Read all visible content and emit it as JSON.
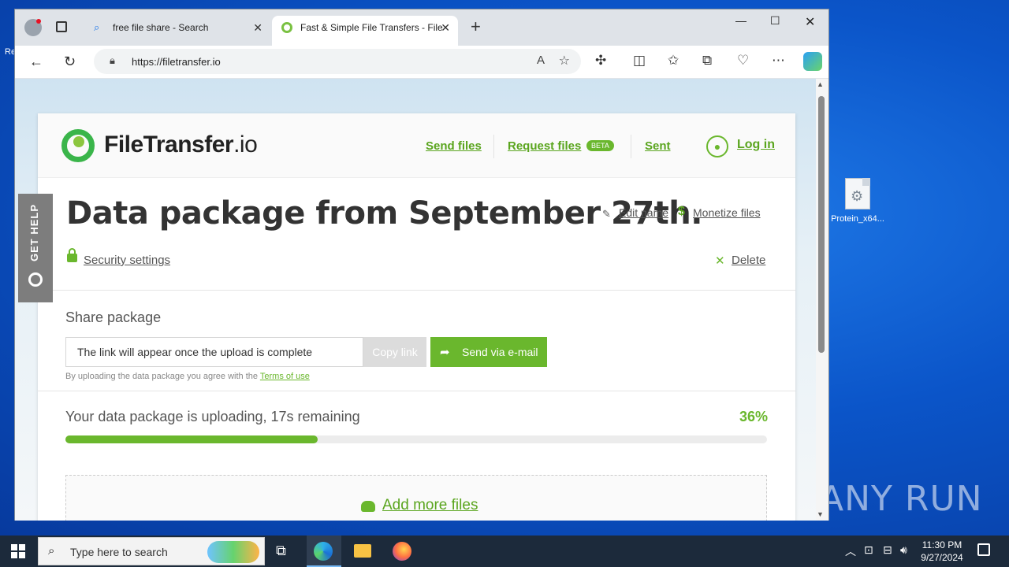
{
  "browser": {
    "tabs": [
      {
        "label": "free file share - Search"
      },
      {
        "label": "Fast & Simple File Transfers - File"
      }
    ],
    "url": "https://filetransfer.io"
  },
  "site": {
    "logo_main": "FileTransfer",
    "logo_tld": ".io",
    "nav": {
      "send_files": "Send files",
      "request_files": "Request files",
      "beta": "BETA",
      "sent": "Sent",
      "login": "Log in"
    },
    "get_help": "GET HELP"
  },
  "package": {
    "title": "Data package from September 27th.",
    "edit_name": "Edit name",
    "monetize": "Monetize files",
    "security": "Security settings",
    "delete": "Delete"
  },
  "share": {
    "heading": "Share package",
    "link_value": "The link will appear once the upload is complete",
    "copy_label": "Copy link",
    "email_label": "Send via e-mail",
    "terms_prefix": "By uploading the data package you agree with the ",
    "terms_link": "Terms of use"
  },
  "upload": {
    "status": "Your data package is uploading, 17s remaining",
    "percent_label": "36%",
    "progress": 0.36,
    "add_more": "Add more files"
  },
  "desktop": {
    "file_label": "Protein_x64...",
    "watermark": "ANY RUN"
  },
  "taskbar": {
    "search_placeholder": "Type here to search",
    "time": "11:30 PM",
    "date": "9/27/2024"
  },
  "colors": {
    "accent": "#6ab72d",
    "accent_dark": "#5aa51e",
    "taskbar": "#1c2a3b"
  }
}
